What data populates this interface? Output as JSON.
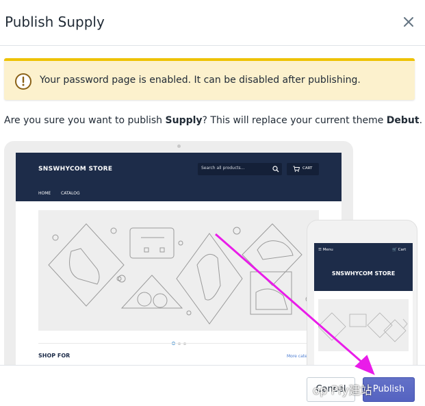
{
  "modal": {
    "title": "Publish Supply",
    "close_icon": "close-icon"
  },
  "banner": {
    "icon": "warning-icon",
    "message": "Your password page is enabled. It can be disabled after publishing."
  },
  "question": {
    "prefix": "Are you sure you want to publish ",
    "theme_new": "Supply",
    "middle": "? This will replace your current theme ",
    "theme_current": "Debut",
    "suffix": "."
  },
  "preview": {
    "desktop": {
      "store_name": "SNSWHYCOM STORE",
      "search_placeholder": "Search all products...",
      "cart_label": "CART",
      "nav": [
        "HOME",
        "CATALOG"
      ],
      "section_title": "SHOP FOR",
      "more_link": "More categ"
    },
    "mobile": {
      "menu_label": "Menu",
      "cart_label": "Cart",
      "store_name": "SNSWHYCOM STORE"
    }
  },
  "footer": {
    "cancel_label": "Cancel",
    "publish_label": "Publish"
  },
  "overlay": {
    "watermark_text": "op Pfy建站",
    "arrow_color": "#e91ce9"
  },
  "colors": {
    "banner_bg": "#fcf1cd",
    "banner_accent": "#eec200",
    "store_navy": "#1d2c49",
    "primary_button": "#5c6ac4"
  }
}
